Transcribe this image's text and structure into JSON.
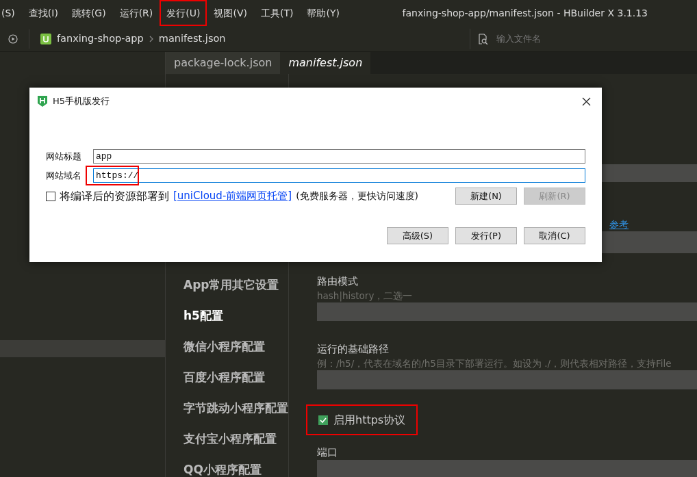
{
  "menu_bar": {
    "items": [
      {
        "label": "(S)",
        "highlighted": false
      },
      {
        "label": "查找(I)",
        "highlighted": false
      },
      {
        "label": "跳转(G)",
        "highlighted": false
      },
      {
        "label": "运行(R)",
        "highlighted": false
      },
      {
        "label": "发行(U)",
        "highlighted": true
      },
      {
        "label": "视图(V)",
        "highlighted": false
      },
      {
        "label": "工具(T)",
        "highlighted": false
      },
      {
        "label": "帮助(Y)",
        "highlighted": false
      }
    ]
  },
  "window": {
    "title": "fanxing-shop-app/manifest.json - HBuilder X 3.1.13"
  },
  "toolbar": {
    "breadcrumb": [
      "fanxing-shop-app",
      "manifest.json"
    ],
    "search": {
      "placeholder": "输入文件名"
    }
  },
  "sidebar": {
    "rows": [
      {
        "selected": true
      }
    ]
  },
  "tabs": [
    {
      "label": "package-lock.json",
      "selected": false
    },
    {
      "label": "manifest.json",
      "selected": true
    }
  ],
  "config_nav": {
    "items": [
      {
        "label": "App常用其它设置",
        "selected": false
      },
      {
        "label": "h5配置",
        "selected": true
      },
      {
        "label": "微信小程序配置",
        "selected": false
      },
      {
        "label": "百度小程序配置",
        "selected": false
      },
      {
        "label": "字节跳动小程序配置",
        "selected": false
      },
      {
        "label": "支付宝小程序配置",
        "selected": false
      },
      {
        "label": "QQ小程序配置",
        "selected": false
      }
    ]
  },
  "editor": {
    "fields": [
      {
        "kind": "input"
      },
      {
        "kind": "link",
        "label": "参考"
      },
      {
        "kind": "input"
      },
      {
        "kind": "input",
        "label": "路由模式",
        "hint": "hash|history，二选一"
      },
      {
        "kind": "input",
        "label": "运行的基础路径",
        "hint": "例：/h5/，代表在域名的/h5目录下部署运行。如设为 ./，则代表相对路径，支持File"
      },
      {
        "kind": "checkbox",
        "label": "启用https协议",
        "checked": true,
        "highlighted": true
      },
      {
        "kind": "input",
        "label": "端口"
      }
    ]
  },
  "dialog": {
    "title": "H5手机版发行",
    "fields": [
      {
        "label": "网站标题",
        "value": "app",
        "focused": false,
        "highlighted": false
      },
      {
        "label": "网站域名",
        "value": "https://",
        "focused": true,
        "highlighted": true
      }
    ],
    "deploy": {
      "checked": false,
      "label": "将编译后的资源部署到",
      "link": "[uniCloud-前端网页托管]",
      "note": "(免费服务器，更快访问速度)"
    },
    "side_buttons": [
      {
        "label": "新建(N)",
        "disabled": false
      },
      {
        "label": "刷新(R)",
        "disabled": true
      }
    ],
    "buttons": [
      "高级(S)",
      "发行(P)",
      "取消(C)"
    ]
  }
}
